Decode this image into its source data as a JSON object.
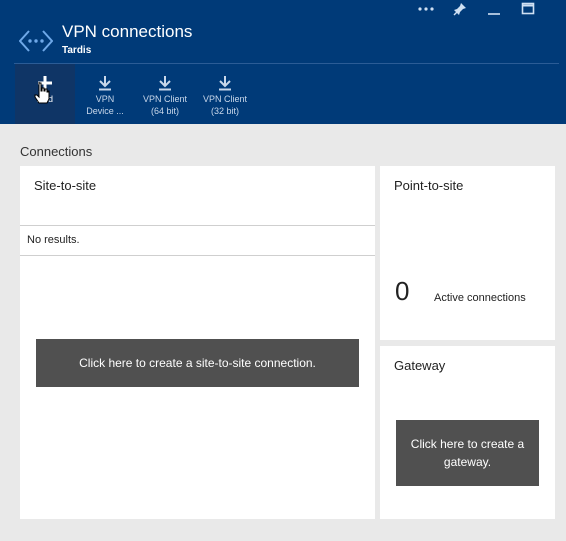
{
  "header": {
    "title": "VPN connections",
    "subtitle": "Tardis",
    "colors": {
      "background": "#003a78",
      "toolbar_active": "#0f3566"
    },
    "window_controls": [
      {
        "name": "more-icon",
        "glyph": "•••"
      },
      {
        "name": "pin-icon",
        "glyph": "📌"
      },
      {
        "name": "minimize-icon",
        "glyph": "—"
      },
      {
        "name": "maximize-icon",
        "glyph": "☐"
      }
    ]
  },
  "toolbar": {
    "items": [
      {
        "label": "Add",
        "icon": "plus-icon",
        "active": true
      },
      {
        "label": "VPN\nDevice ...",
        "icon": "download-icon"
      },
      {
        "label": "VPN Client\n(64 bit)",
        "icon": "download-icon"
      },
      {
        "label": "VPN Client\n(32 bit)",
        "icon": "download-icon"
      }
    ]
  },
  "connections": {
    "label": "Connections",
    "site_to_site": {
      "title": "Site-to-site",
      "results_text": "No results.",
      "cta": "Click here to create a site-to-site connection."
    },
    "point_to_site": {
      "title": "Point-to-site",
      "count": "0",
      "count_label": "Active connections"
    },
    "gateway": {
      "title": "Gateway",
      "cta": "Click here to create a gateway."
    }
  }
}
